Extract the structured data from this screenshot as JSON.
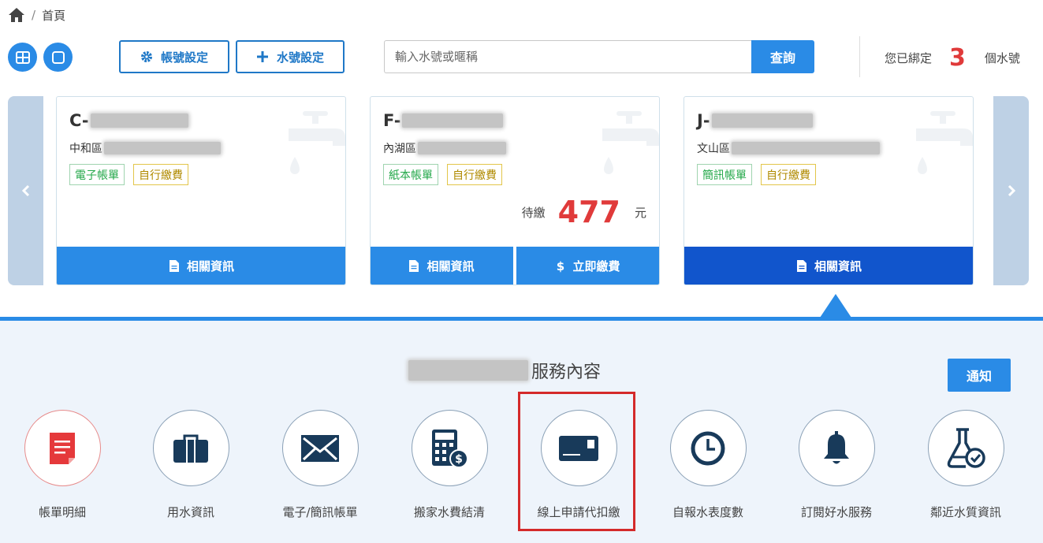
{
  "breadcrumb": {
    "home_icon": "home-icon",
    "separator": "/",
    "current": "首頁"
  },
  "toolbar": {
    "account_settings": "帳號設定",
    "water_settings": "水號設定",
    "search_placeholder": "輸入水號或暱稱",
    "search_button": "查詢",
    "bound_prefix": "您已綁定",
    "bound_count": "3",
    "bound_suffix": "個水號"
  },
  "cards": [
    {
      "account_prefix": "C-",
      "district": "中和區",
      "tags": [
        "電子帳單",
        "自行繳費"
      ],
      "button": "相關資訊"
    },
    {
      "account_prefix": "F-",
      "district": "內湖區",
      "tags": [
        "紙本帳單",
        "自行繳費"
      ],
      "due_label": "待繳",
      "due_amount": "477",
      "due_unit": "元",
      "button": "相關資訊",
      "pay_button": "立即繳費"
    },
    {
      "account_prefix": "J-",
      "district": "文山區",
      "tags": [
        "簡訊帳單",
        "自行繳費"
      ],
      "button": "相關資訊"
    }
  ],
  "services": {
    "title_suffix": "服務內容",
    "notify_button": "通知",
    "items": [
      {
        "label": "帳單明細",
        "icon": "bill-icon"
      },
      {
        "label": "用水資訊",
        "icon": "briefcase-icon"
      },
      {
        "label": "電子/簡訊帳單",
        "icon": "envelope-icon"
      },
      {
        "label": "搬家水費結清",
        "icon": "calculator-icon"
      },
      {
        "label": "線上申請代扣繳",
        "icon": "card-icon"
      },
      {
        "label": "自報水表度數",
        "icon": "clock-icon"
      },
      {
        "label": "訂閱好水服務",
        "icon": "bell-icon"
      },
      {
        "label": "鄰近水質資訊",
        "icon": "flask-icon"
      }
    ]
  },
  "colors": {
    "primary": "#2a8be6",
    "dark_primary": "#1155cc",
    "accent_red": "#e03a3a",
    "panel_bg": "#eef4fb"
  }
}
